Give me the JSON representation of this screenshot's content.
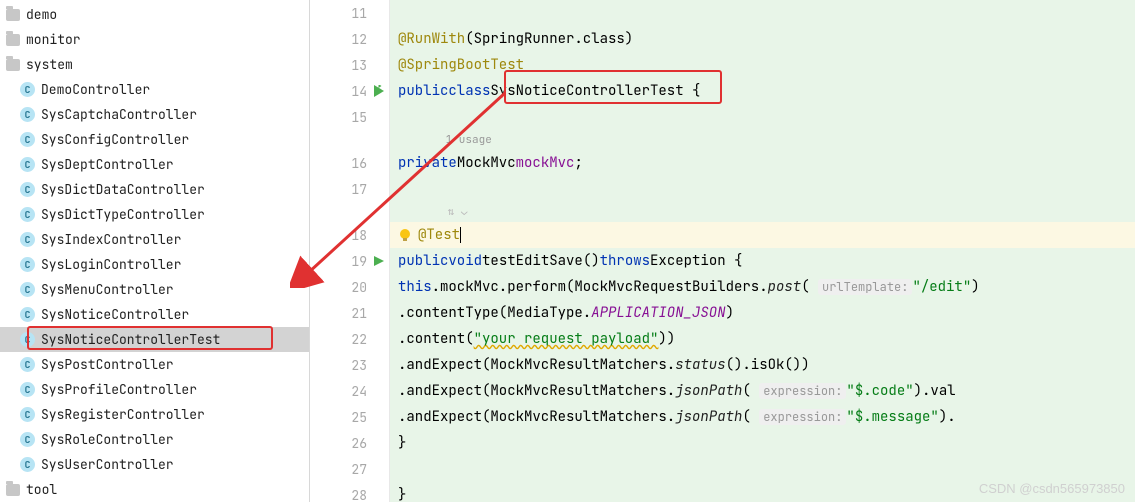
{
  "sidebar": {
    "items": [
      {
        "type": "folder",
        "label": "demo",
        "depth": 0
      },
      {
        "type": "folder",
        "label": "monitor",
        "depth": 0
      },
      {
        "type": "folder",
        "label": "system",
        "depth": 0
      },
      {
        "type": "class",
        "label": "DemoController",
        "depth": 1
      },
      {
        "type": "class",
        "label": "SysCaptchaController",
        "depth": 1
      },
      {
        "type": "class",
        "label": "SysConfigController",
        "depth": 1
      },
      {
        "type": "class",
        "label": "SysDeptController",
        "depth": 1
      },
      {
        "type": "class",
        "label": "SysDictDataController",
        "depth": 1
      },
      {
        "type": "class",
        "label": "SysDictTypeController",
        "depth": 1
      },
      {
        "type": "class",
        "label": "SysIndexController",
        "depth": 1
      },
      {
        "type": "class",
        "label": "SysLoginController",
        "depth": 1
      },
      {
        "type": "class",
        "label": "SysMenuController",
        "depth": 1
      },
      {
        "type": "class",
        "label": "SysNoticeController",
        "depth": 1
      },
      {
        "type": "class",
        "label": "SysNoticeControllerTest",
        "depth": 1,
        "selected": true
      },
      {
        "type": "class",
        "label": "SysPostController",
        "depth": 1
      },
      {
        "type": "class",
        "label": "SysProfileController",
        "depth": 1
      },
      {
        "type": "class",
        "label": "SysRegisterController",
        "depth": 1
      },
      {
        "type": "class",
        "label": "SysRoleController",
        "depth": 1
      },
      {
        "type": "class",
        "label": "SysUserController",
        "depth": 1
      },
      {
        "type": "folder",
        "label": "tool",
        "depth": 0
      }
    ]
  },
  "gutter": {
    "lines": [
      "11",
      "12",
      "13",
      "14",
      "15",
      "",
      "16",
      "17",
      "",
      "18",
      "19",
      "20",
      "21",
      "22",
      "23",
      "24",
      "25",
      "26",
      "27",
      "28"
    ]
  },
  "code": {
    "line11": "",
    "line12_ann": "@RunWith",
    "line12_rest": "(SpringRunner.class)",
    "line13_ann": "@SpringBootTest",
    "line14_kw1": "public",
    "line14_kw2": "class",
    "line14_name": "SysNoticeControllerTest",
    "line14_brace": " {",
    "usage_hint": "1 usage",
    "line16_kw": "private",
    "line16_type": "MockMvc",
    "line16_var": "mockMvc",
    "line18_ann": "@Test",
    "line19_kw1": "public",
    "line19_kw2": "void",
    "line19_name": "testEditSave()",
    "line19_kw3": "throws",
    "line19_exc": "Exception {",
    "line20_this": "this",
    "line20_a": ".mockMvc.perform(MockMvcRequestBuilders.",
    "line20_post": "post",
    "line20_hint": "urlTemplate:",
    "line20_str": "\"/edit\"",
    "line20_end": ")",
    "line21_a": ".contentType(MediaType.",
    "line21_const": "APPLICATION_JSON",
    "line21_end": ")",
    "line22_a": ".content(",
    "line22_str": "\"your request payload\"",
    "line22_end": "))",
    "line23_a": ".andExpect(MockMvcResultMatchers.",
    "line23_m": "status",
    "line23_end": "().isOk())",
    "line24_a": ".andExpect(MockMvcResultMatchers.",
    "line24_m": "jsonPath",
    "line24_hint": "expression:",
    "line24_str": "\"$.code\"",
    "line24_end": ").val",
    "line25_a": ".andExpect(MockMvcResultMatchers.",
    "line25_m": "jsonPath",
    "line25_hint": "expression:",
    "line25_str": "\"$.message\"",
    "line25_end": ").",
    "line26": "}",
    "line28": "}"
  },
  "watermark": "CSDN @csdn565973850"
}
